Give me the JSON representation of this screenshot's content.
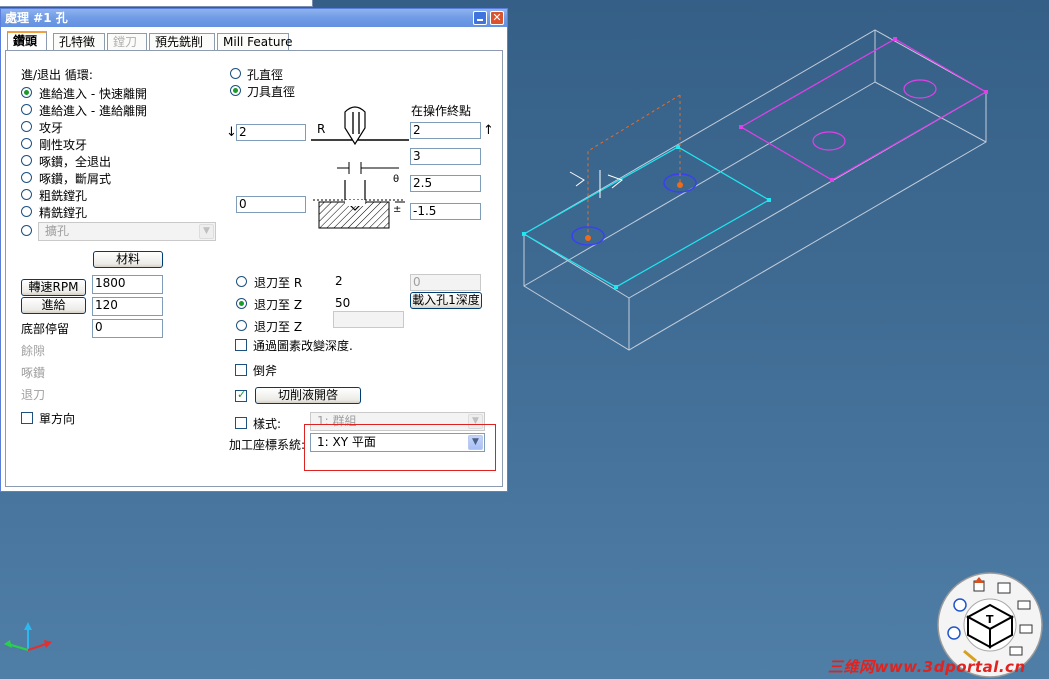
{
  "window": {
    "title": "處理 #1 孔"
  },
  "tabs": [
    {
      "label": "鑽頭"
    },
    {
      "label": "孔特徵"
    },
    {
      "label": "鏜刀"
    },
    {
      "label": "預先銑削"
    },
    {
      "label": "Mill Feature"
    }
  ],
  "cycle": {
    "heading": "進/退出 循環:",
    "options": [
      "進給進入 - 快速離開",
      "進給進入 - 進給離開",
      "攻牙",
      "剛性攻牙",
      "啄鑽，全退出",
      "啄鑽，斷屑式",
      "粗銑鏜孔",
      "精銑鏜孔"
    ],
    "selected_index": 0,
    "custom_select": "擴孔"
  },
  "diameter": {
    "options": [
      "孔直徑",
      "刀具直徑"
    ],
    "selected_index": 1
  },
  "endpoint": {
    "label": "在操作終點"
  },
  "params": {
    "r_label": "R",
    "left_top_value": "2",
    "left_bottom_value": "0",
    "right_values": [
      "2",
      "3",
      "2.5",
      "-1.5"
    ],
    "theta": "θ"
  },
  "material_button": "材料",
  "rpm_button": "轉速RPM",
  "rpm_value": "1800",
  "feed_button": "進給",
  "feed_value": "120",
  "dwell_label": "底部停留",
  "dwell_value": "0",
  "disabled_labels": [
    "餘隙",
    "啄鑽",
    "退刀"
  ],
  "one_way": "單方向",
  "retract": {
    "options": [
      {
        "label": "退刀至 R",
        "value": "2"
      },
      {
        "label": "退刀至 Z",
        "value": "50"
      },
      {
        "label": "退刀至 Z",
        "value": ""
      }
    ],
    "selected_index": 1,
    "side_value": "0",
    "load_depth_button": "載入孔1深度"
  },
  "checks": {
    "change_depth": "通過圖素改變深度.",
    "chamfer": "倒斧",
    "coolant_button": "切削液開啓",
    "style_label": "樣式:",
    "style_value": "1: 群組"
  },
  "coord_system": {
    "label": "加工座標系統:",
    "value": "1: XY 平面"
  },
  "watermark": "三维网www.3dportal.cn",
  "nav_cube": {
    "face_label": "T"
  },
  "colors": {
    "accent_cyan": "#1fe6f0",
    "magenta": "#e040e8",
    "orange": "#f06a18",
    "hole_blue": "#3a40f0"
  }
}
